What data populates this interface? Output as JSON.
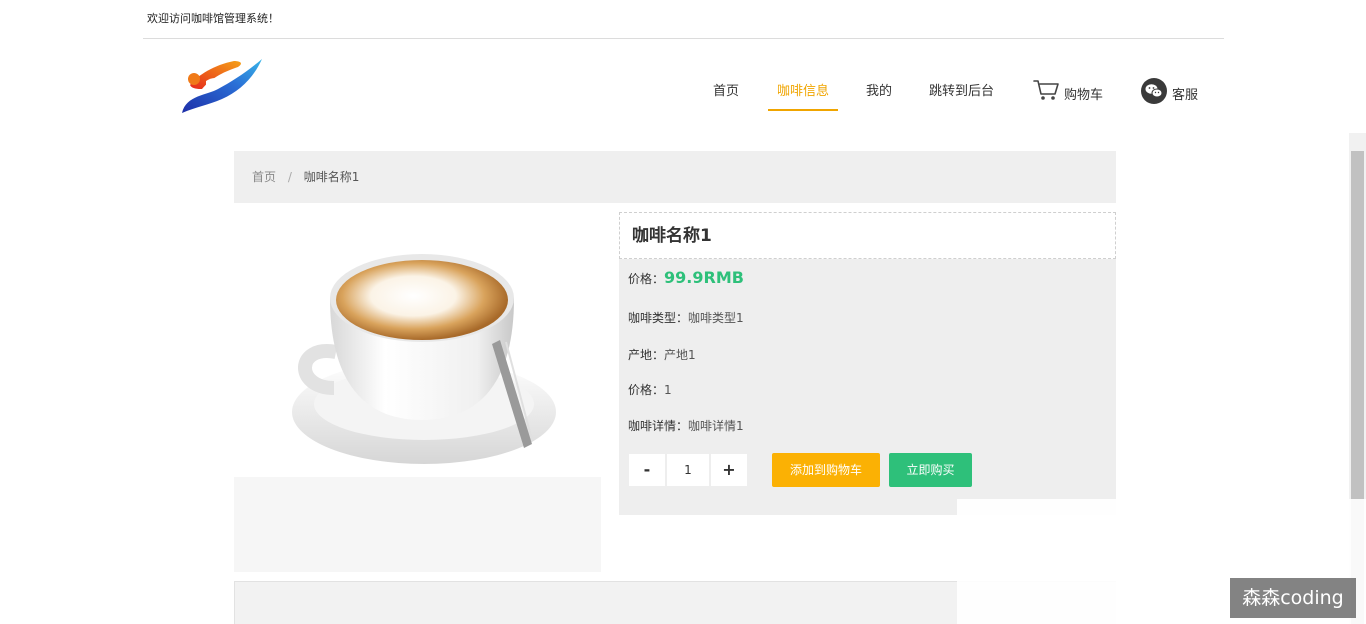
{
  "topbar": {
    "welcome": "欢迎访问咖啡馆管理系统！"
  },
  "nav": {
    "items": [
      {
        "label": "首页"
      },
      {
        "label": "咖啡信息"
      },
      {
        "label": "我的"
      },
      {
        "label": "跳转到后台"
      },
      {
        "label": "购物车",
        "icon": "cart-icon"
      },
      {
        "label": "客服",
        "icon": "wechat-icon"
      }
    ],
    "active_color": "#f0a500"
  },
  "breadcrumb": {
    "home": "首页",
    "separator": "/",
    "current": "咖啡名称1"
  },
  "product": {
    "title": "咖啡名称1",
    "price_label": "价格：",
    "price_value": "99.9RMB",
    "type_label": "咖啡类型：",
    "type_value": "咖啡类型1",
    "origin_label": "产地：",
    "origin_value": "产地1",
    "price2_label": "价格：",
    "price2_value": "1",
    "detail_label": "咖啡详情：",
    "detail_value": "咖啡详情1",
    "image_icon": "coffee-cup-image"
  },
  "quantity": {
    "minus": "-",
    "value": "1",
    "plus": "+"
  },
  "actions": {
    "add_to_cart": "添加到购物车",
    "buy_now": "立即购买"
  },
  "colors": {
    "accent_yellow": "#fbb104",
    "accent_green": "#2ec07a"
  },
  "watermark": "森森coding"
}
